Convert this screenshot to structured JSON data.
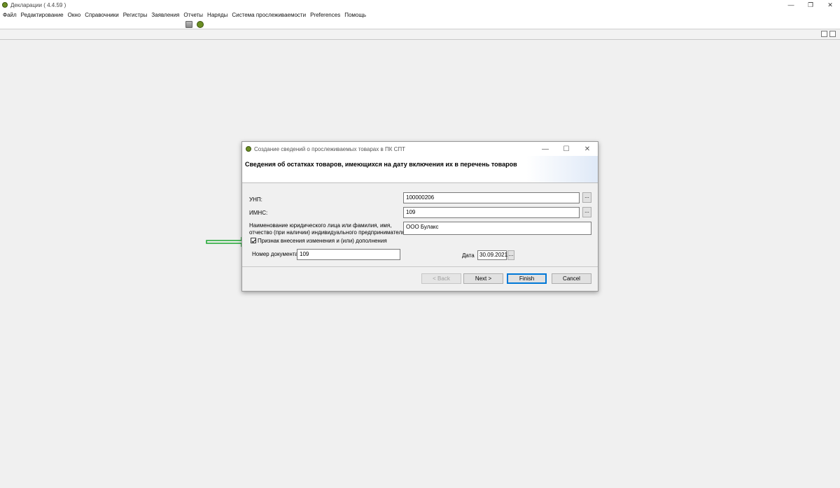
{
  "window": {
    "title": "Декларации ( 4.4.59 )",
    "controls": {
      "minimize": "—",
      "restore": "❐",
      "close": "✕"
    }
  },
  "menu": [
    "Файл",
    "Редактирование",
    "Окно",
    "Справочники",
    "Регистры",
    "Заявления",
    "Отчеты",
    "Наряды",
    "Система прослеживаемости",
    "Preferences",
    "Помощь"
  ],
  "dialog": {
    "title": "Создание сведений о прослеживаемых товарах в ПК СПТ",
    "heading": "Сведения об остатках товаров, имеющихся на дату включения их в перечень товаров",
    "unp": {
      "label": "УНП:",
      "value": "100000206",
      "browse": "..."
    },
    "imns": {
      "label": "ИМНС:",
      "value": "109",
      "browse": "..."
    },
    "name": {
      "label_line1": "Наименование  юридического лица или фамилия, имя,",
      "label_line2": "отчество (при наличии) индивидуального предпринимателя",
      "value": "ООО Булакс"
    },
    "change_flag": {
      "label": "Признак внесения изменения и (или) дополнения",
      "checked": true
    },
    "doc_number": {
      "label": "Номер документа",
      "value": "109"
    },
    "date": {
      "label": "Дата",
      "value": "30.09.2021",
      "browse": "..."
    },
    "buttons": {
      "back": "< Back",
      "next": "Next >",
      "finish": "Finish",
      "cancel": "Cancel"
    }
  },
  "colors": {
    "arrow": "#1aa52e",
    "accent": "#0078d7",
    "brand_icon": "#6b8e23"
  }
}
